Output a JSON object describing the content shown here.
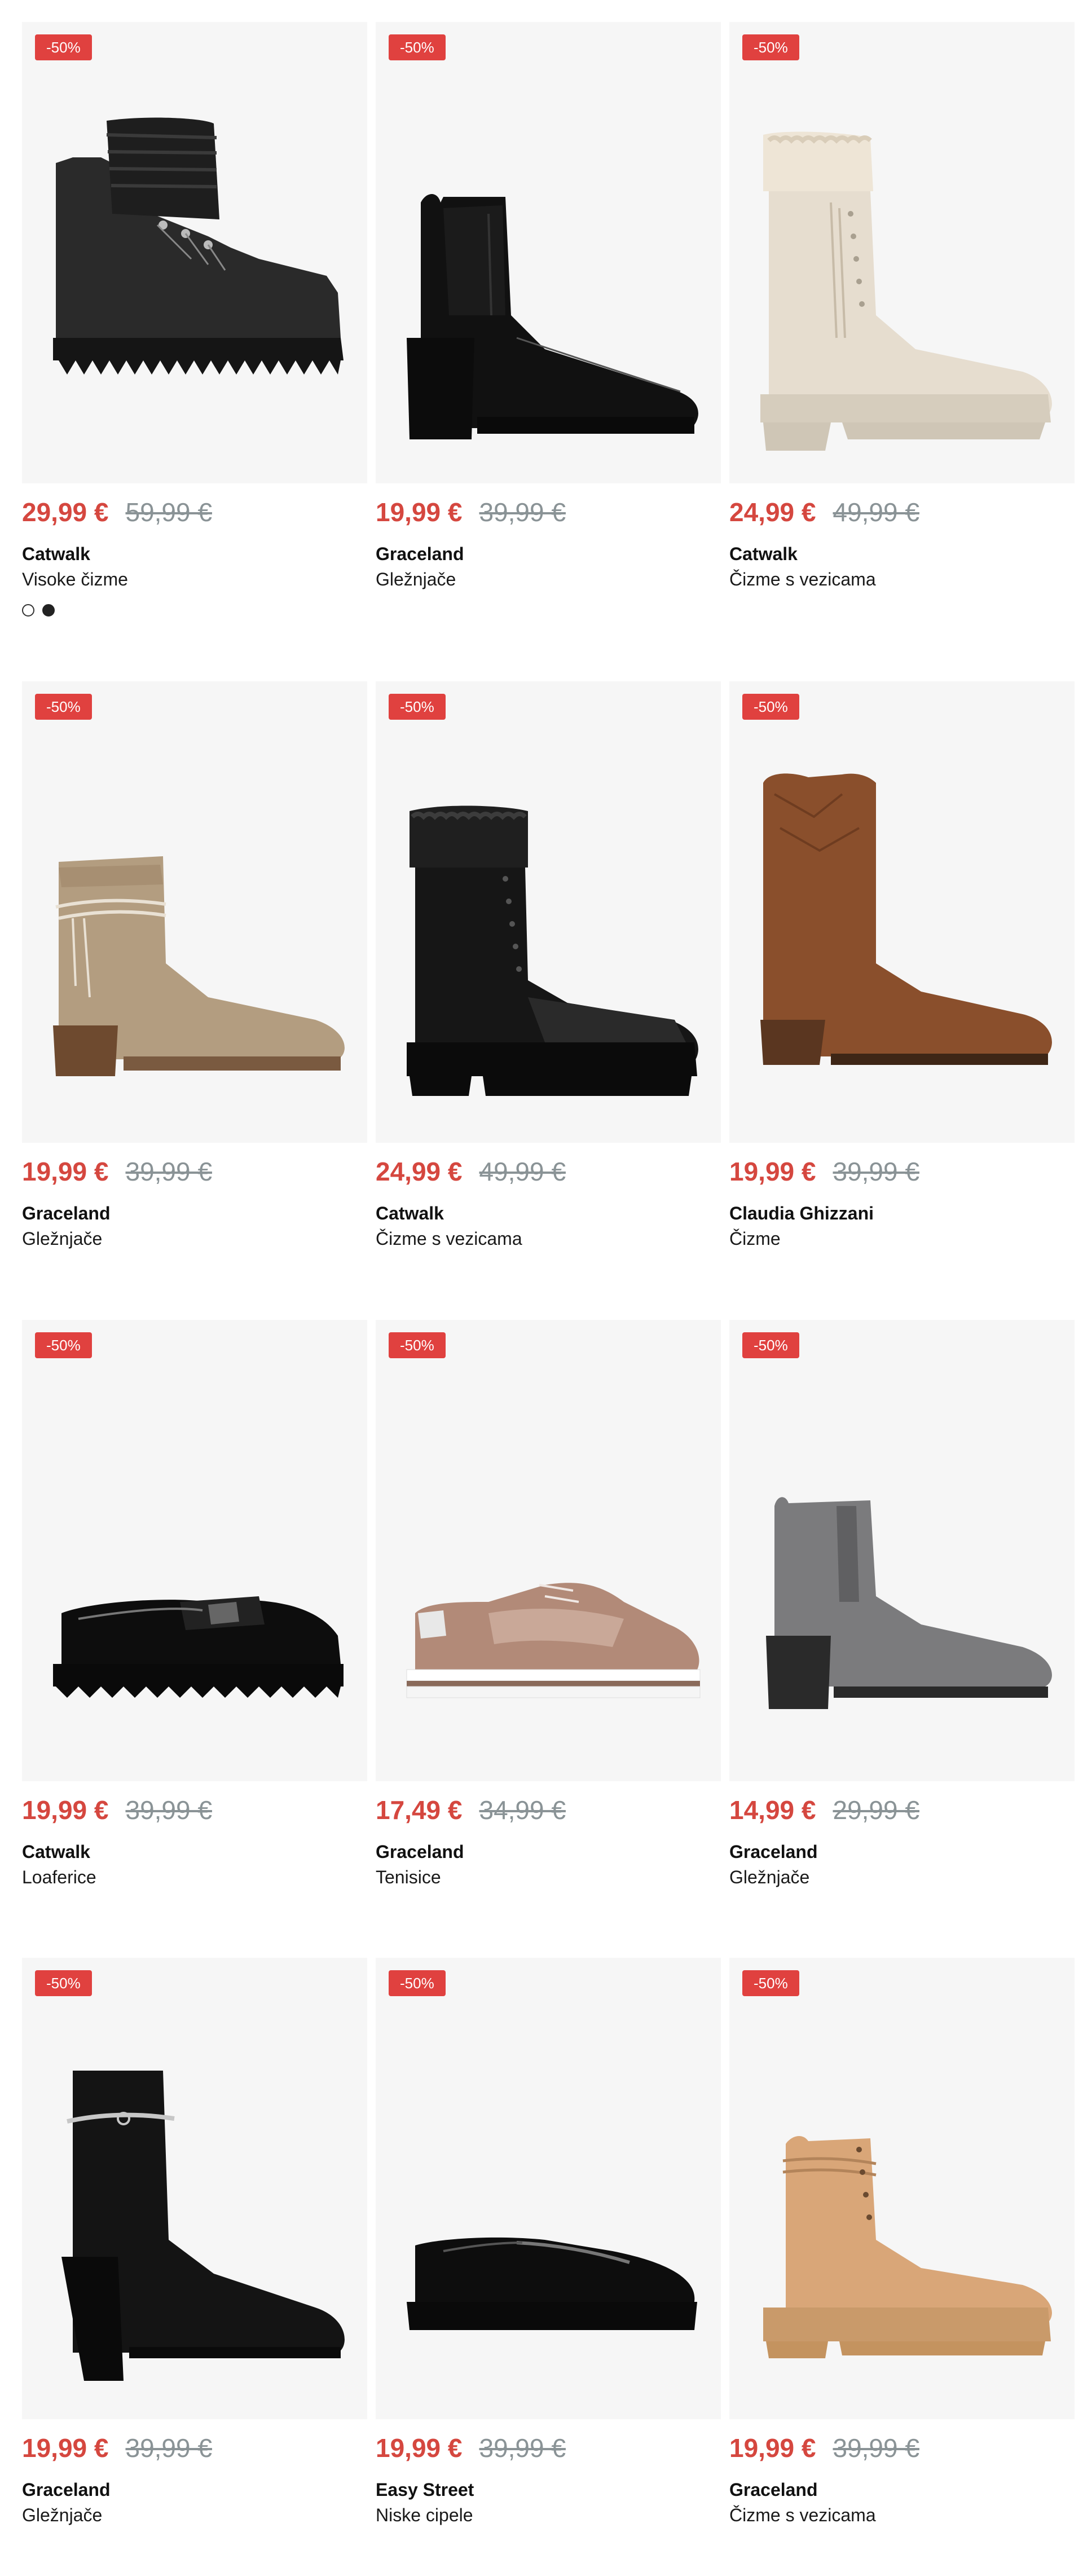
{
  "colors": {
    "badge_bg": "#e0413f",
    "price_new": "#d5473f",
    "price_old": "#8a9396",
    "image_bg": "#f6f6f6"
  },
  "products": [
    {
      "badge": "-50%",
      "price": "29,99 €",
      "old_price": "59,99 €",
      "brand": "Catwalk",
      "category": "Visoke čizme",
      "icon": "chunky-hiking-boot-icon",
      "swatches": [
        "white",
        "black"
      ]
    },
    {
      "badge": "-50%",
      "price": "19,99 €",
      "old_price": "39,99 €",
      "brand": "Graceland",
      "category": "Gležnjače",
      "icon": "ankle-boot-icon"
    },
    {
      "badge": "-50%",
      "price": "24,99 €",
      "old_price": "49,99 €",
      "brand": "Catwalk",
      "category": "Čizme s vezicama",
      "icon": "lace-up-boot-icon"
    },
    {
      "badge": "-50%",
      "price": "19,99 €",
      "old_price": "39,99 €",
      "brand": "Graceland",
      "category": "Gležnjače",
      "icon": "ankle-boot-icon"
    },
    {
      "badge": "-50%",
      "price": "24,99 €",
      "old_price": "49,99 €",
      "brand": "Catwalk",
      "category": "Čizme s vezicama",
      "icon": "lace-up-boot-icon"
    },
    {
      "badge": "-50%",
      "price": "19,99 €",
      "old_price": "39,99 €",
      "brand": "Claudia Ghizzani",
      "category": "Čizme",
      "icon": "cowboy-boot-icon"
    },
    {
      "badge": "-50%",
      "price": "19,99 €",
      "old_price": "39,99 €",
      "brand": "Catwalk",
      "category": "Loaferice",
      "icon": "loafer-icon"
    },
    {
      "badge": "-50%",
      "price": "17,49 €",
      "old_price": "34,99 €",
      "brand": "Graceland",
      "category": "Tenisice",
      "icon": "sneaker-icon"
    },
    {
      "badge": "-50%",
      "price": "14,99 €",
      "old_price": "29,99 €",
      "brand": "Graceland",
      "category": "Gležnjače",
      "icon": "chelsea-boot-icon"
    },
    {
      "badge": "-50%",
      "price": "19,99 €",
      "old_price": "39,99 €",
      "brand": "Graceland",
      "category": "Gležnjače",
      "icon": "heeled-ankle-boot-icon"
    },
    {
      "badge": "-50%",
      "price": "19,99 €",
      "old_price": "39,99 €",
      "brand": "Easy Street",
      "category": "Niske cipele",
      "icon": "slip-on-shoe-icon"
    },
    {
      "badge": "-50%",
      "price": "19,99 €",
      "old_price": "39,99 €",
      "brand": "Graceland",
      "category": "Čizme s vezicama",
      "icon": "lace-up-boot-icon"
    }
  ]
}
